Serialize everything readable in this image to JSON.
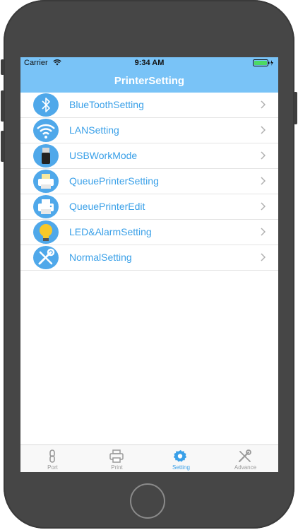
{
  "status_bar": {
    "carrier": "Carrier",
    "time": "9:34 AM",
    "battery_color": "#4cd964"
  },
  "nav": {
    "title": "PrinterSetting",
    "background": "#79c3f7"
  },
  "settings": [
    {
      "label": "BlueToothSetting",
      "icon": "bluetooth-icon"
    },
    {
      "label": "LANSetting",
      "icon": "wifi-icon"
    },
    {
      "label": "USBWorkMode",
      "icon": "usb-icon"
    },
    {
      "label": "QueuePrinterSetting",
      "icon": "printer-queue-icon"
    },
    {
      "label": "QueuePrinterEdit",
      "icon": "printer-edit-icon"
    },
    {
      "label": "LED&AlarmSetting",
      "icon": "lightbulb-icon"
    },
    {
      "label": "NormalSetting",
      "icon": "wrench-screwdriver-icon"
    }
  ],
  "tabs": [
    {
      "label": "Port",
      "icon": "link-icon",
      "active": false
    },
    {
      "label": "Print",
      "icon": "printer-icon",
      "active": false
    },
    {
      "label": "Setting",
      "icon": "gear-icon",
      "active": true
    },
    {
      "label": "Advance",
      "icon": "tools-icon",
      "active": false
    }
  ],
  "colors": {
    "accent": "#3aa0e8",
    "inactive_tab": "#9a9a9a",
    "phone_body": "#464646"
  }
}
